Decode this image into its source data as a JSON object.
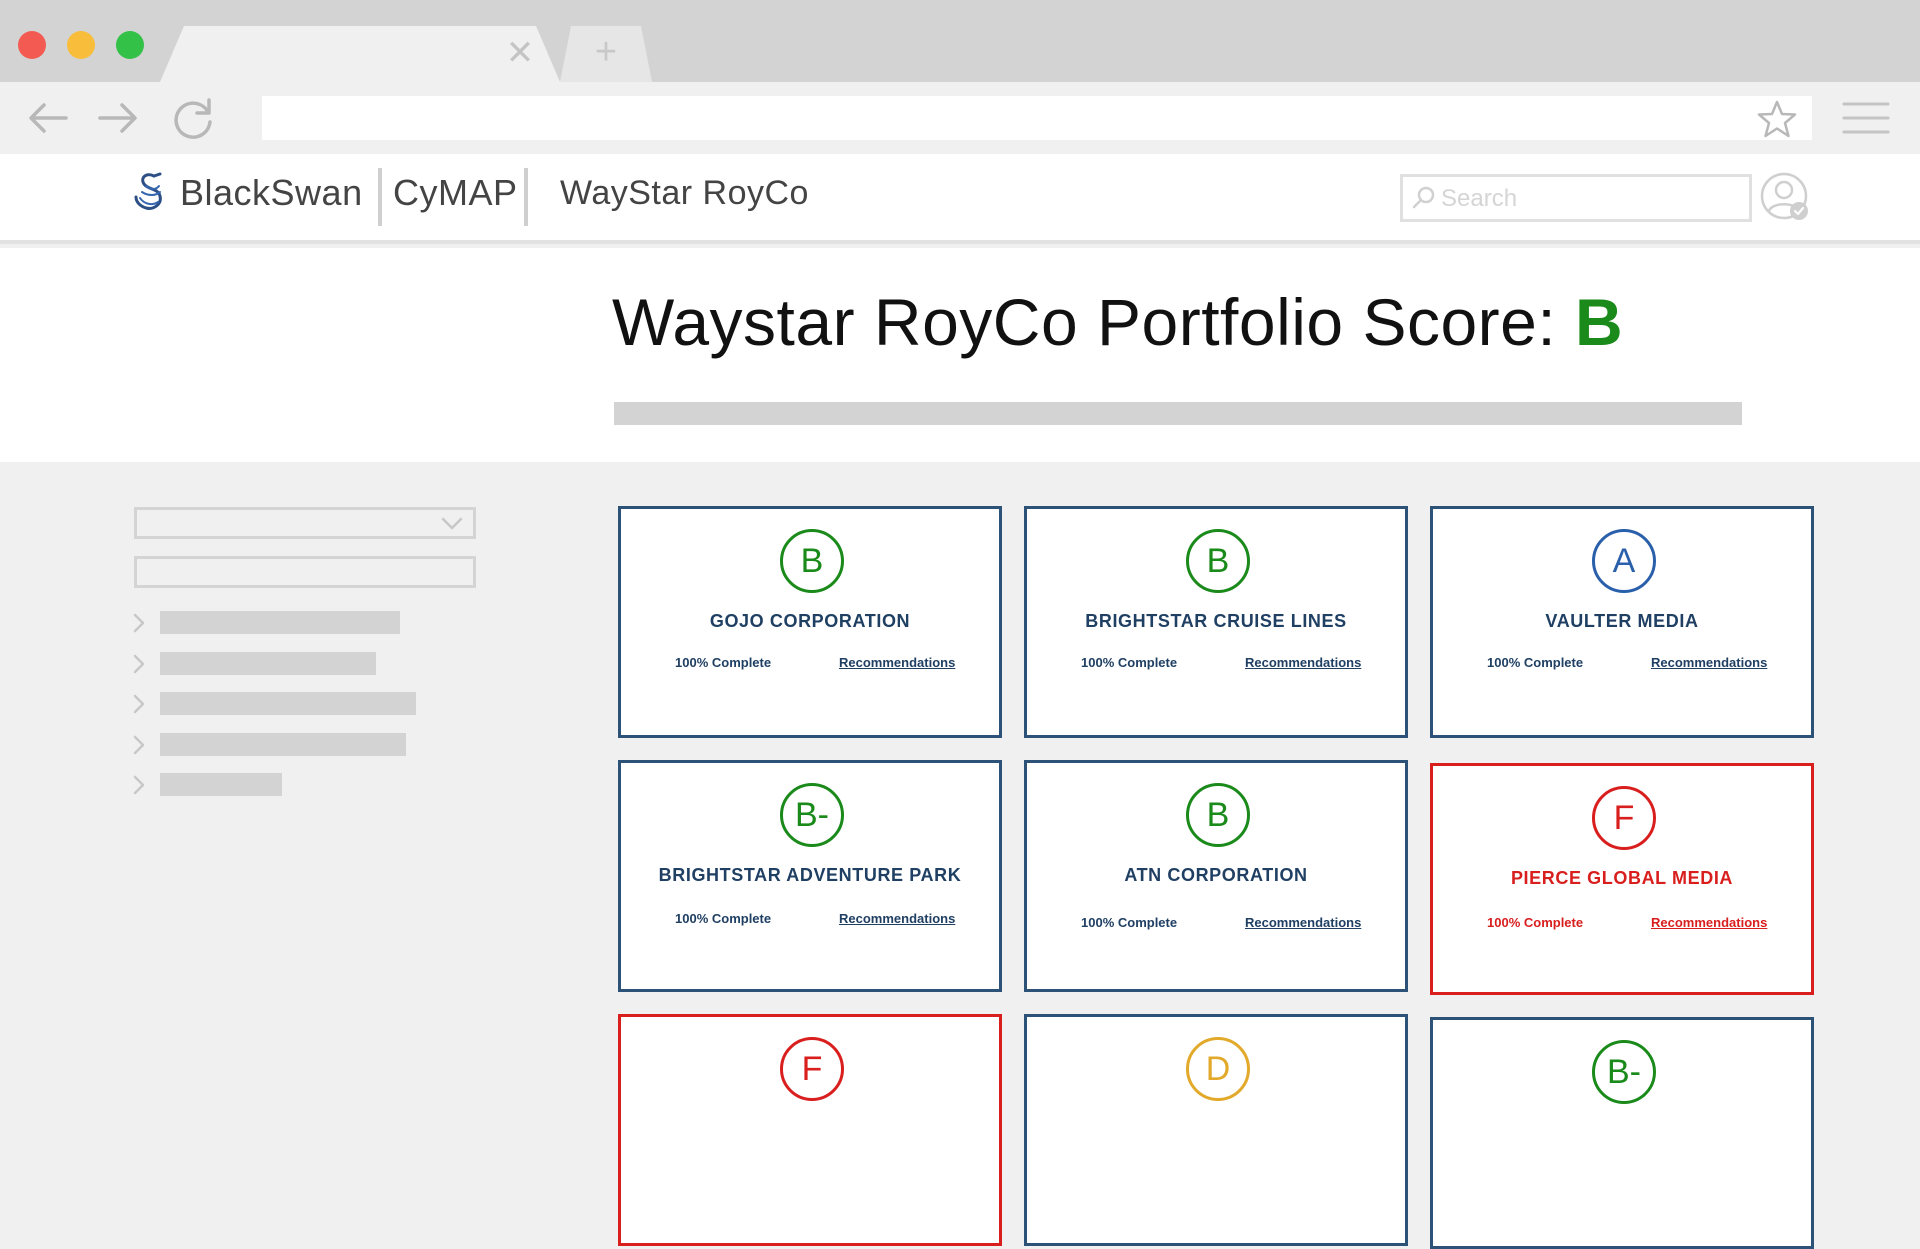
{
  "browser": {
    "new_tab_label": "+",
    "close_tab_glyph": "✕"
  },
  "app": {
    "brand": "BlackSwan",
    "product": "CyMAP",
    "client": "WayStar RoyCo",
    "search_placeholder": "Search"
  },
  "portfolio": {
    "title_prefix": "Waystar RoyCo Portfolio Score: ",
    "grade": "B",
    "grade_color": "#1a8a1a"
  },
  "sidebar": {
    "tree_items": 5
  },
  "colors": {
    "navy": "#1f3f63",
    "green": "#1a8a1a",
    "blue": "#2a5fab",
    "red": "#d91e1e",
    "yellow": "#e2a92a"
  },
  "companies": [
    {
      "grade": "B",
      "name": "GOJO CORPORATION",
      "status": "100% Complete",
      "link": "Recommendations",
      "alert": false
    },
    {
      "grade": "B",
      "name": "BRIGHTSTAR CRUISE LINES",
      "status": "100% Complete",
      "link": "Recommendations",
      "alert": false
    },
    {
      "grade": "A",
      "name": "VAULTER MEDIA",
      "status": "100% Complete",
      "link": "Recommendations",
      "alert": false
    },
    {
      "grade": "B-",
      "name": "BRIGHTSTAR ADVENTURE PARK",
      "status": "100% Complete",
      "link": "Recommendations",
      "alert": false
    },
    {
      "grade": "B",
      "name": "ATN CORPORATION",
      "status": "100% Complete",
      "link": "Recommendations",
      "alert": false
    },
    {
      "grade": "F",
      "name": "PIERCE GLOBAL MEDIA",
      "status": "100% Complete",
      "link": "Recommendations",
      "alert": true
    },
    {
      "grade": "F",
      "name": "",
      "status": "",
      "link": "",
      "alert": true
    },
    {
      "grade": "D",
      "name": "",
      "status": "",
      "link": "",
      "alert": false
    },
    {
      "grade": "B-",
      "name": "",
      "status": "",
      "link": "",
      "alert": false
    }
  ]
}
